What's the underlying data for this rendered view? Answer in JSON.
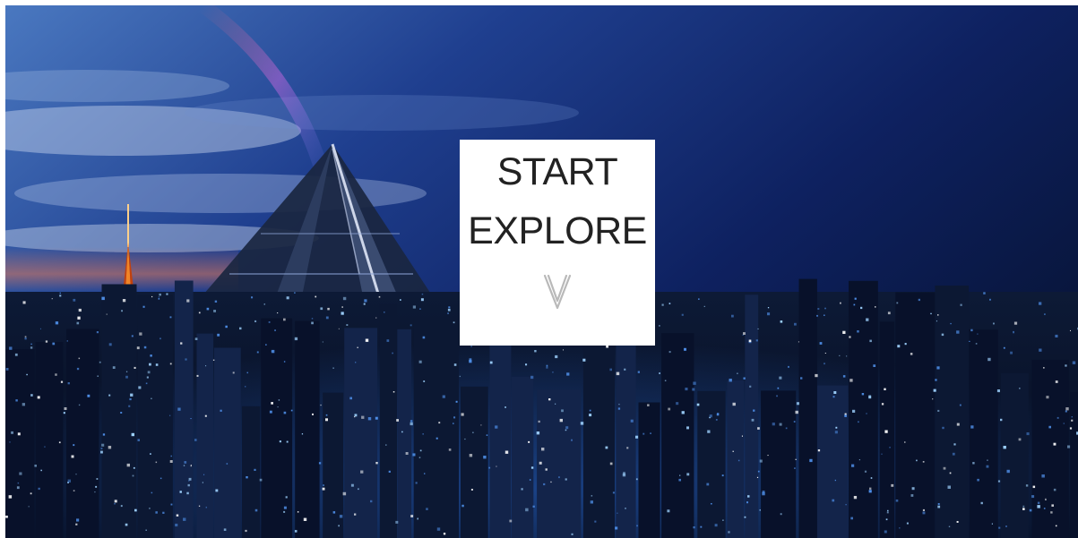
{
  "start_card": {
    "line1": "START",
    "line2": "EXPLORE",
    "icon": "chevron-down-icon"
  },
  "background": {
    "subject": "night-city-skyline",
    "colors": {
      "sky_deep": "#0b1a44",
      "sky_light": "#5b86c8",
      "sunset": "#e0785a",
      "tower_lights": "#ff9a2e",
      "city_lights": "#9fd3ff"
    }
  }
}
